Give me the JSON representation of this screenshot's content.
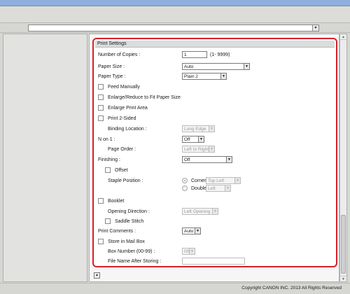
{
  "url_bar": {
    "value": "",
    "dropdown_icon": "chevron-down-icon"
  },
  "settings": {
    "header": "Print Settings",
    "number_of_copies": {
      "label": "Number of Copies :",
      "value": "1",
      "range": "(1- 9999)"
    },
    "paper_size": {
      "label": "Paper Size :",
      "value": "Auto"
    },
    "paper_type": {
      "label": "Paper Type :",
      "value": "Plain 2"
    },
    "feed_manually": {
      "label": "Feed Manually",
      "checked": false
    },
    "enlarge_reduce": {
      "label": "Enlarge/Reduce to Fit Paper Size",
      "checked": false
    },
    "enlarge_print_area": {
      "label": "Enlarge Print Area",
      "checked": false
    },
    "print_2_sided": {
      "label": "Print 2-Sided",
      "checked": false
    },
    "binding_location": {
      "label": "Binding Location :",
      "value": "Long Edge"
    },
    "n_on_1": {
      "label": "N on 1 :",
      "value": "Off"
    },
    "page_order": {
      "label": "Page Order :",
      "value": "Left to Right"
    },
    "finishing": {
      "label": "Finishing :",
      "value": "Off"
    },
    "offset": {
      "label": "Offset",
      "checked": false
    },
    "staple_position": {
      "label": "Staple Position :",
      "corner": {
        "label": "Corner",
        "value": "Top Left",
        "selected": true
      },
      "double": {
        "label": "Double",
        "value": "Left",
        "selected": false
      }
    },
    "booklet": {
      "label": "Booklet",
      "checked": false
    },
    "opening_direction": {
      "label": "Opening Direction :",
      "value": "Left Opening"
    },
    "saddle_stitch": {
      "label": "Saddle Stitch",
      "checked": false
    },
    "print_comments": {
      "label": "Print Comments :",
      "value": "Auto"
    },
    "store_in_mailbox": {
      "label": "Store in Mail Box",
      "checked": false
    },
    "box_number": {
      "label": "Box Number (00-99) :",
      "value": "00"
    },
    "file_name_after_storing": {
      "label": "File Name After Storing :",
      "value": ""
    }
  },
  "status_bar": {
    "copyright": "Copyright CANON INC. 2013 All Rights Reserved"
  },
  "colors": {
    "highlight_border": "#d8202a",
    "title_bar": "#8eaede"
  }
}
